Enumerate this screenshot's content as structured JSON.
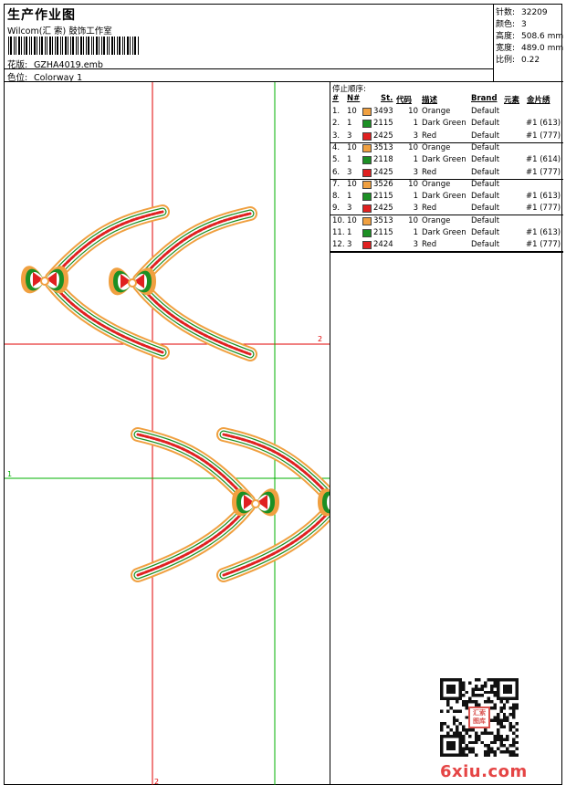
{
  "header": {
    "title": "生产作业图",
    "company": "Wilcom(汇 索) 鼓饰工作室",
    "design_label": "花版:",
    "design_value": "GZHA4019.emb",
    "colorway_label": "色位:",
    "colorway_value": "Colorway 1"
  },
  "stats": [
    {
      "label": "针数:",
      "value": "32209"
    },
    {
      "label": "颜色:",
      "value": "3"
    },
    {
      "label": "高度:",
      "value": "508.6 mm"
    },
    {
      "label": "宽度:",
      "value": "489.0 mm"
    },
    {
      "label": "比例:",
      "value": "0.22"
    }
  ],
  "stop_sequence": {
    "title": "停止顺序:",
    "columns": [
      "#",
      "N#",
      "St.",
      "代码",
      "描述",
      "Brand",
      "元素",
      "金片绣"
    ],
    "rows": [
      {
        "num": "1.",
        "n": "10",
        "color": "#f0a040",
        "st": "3493",
        "code": "10",
        "desc": "Orange",
        "brand": "Default",
        "seq": ""
      },
      {
        "num": "2.",
        "n": "1",
        "color": "#1c8f24",
        "st": "2115",
        "code": "1",
        "desc": "Dark Green",
        "brand": "Default",
        "seq": "#1 (613)"
      },
      {
        "num": "3.",
        "n": "3",
        "color": "#e02020",
        "st": "2425",
        "code": "3",
        "desc": "Red",
        "brand": "Default",
        "seq": "#1 (777)"
      },
      {
        "num": "4.",
        "n": "10",
        "color": "#f0a040",
        "st": "3513",
        "code": "10",
        "desc": "Orange",
        "brand": "Default",
        "seq": ""
      },
      {
        "num": "5.",
        "n": "1",
        "color": "#1c8f24",
        "st": "2118",
        "code": "1",
        "desc": "Dark Green",
        "brand": "Default",
        "seq": "#1 (614)"
      },
      {
        "num": "6.",
        "n": "3",
        "color": "#e02020",
        "st": "2425",
        "code": "3",
        "desc": "Red",
        "brand": "Default",
        "seq": "#1 (777)"
      },
      {
        "num": "7.",
        "n": "10",
        "color": "#f0a040",
        "st": "3526",
        "code": "10",
        "desc": "Orange",
        "brand": "Default",
        "seq": ""
      },
      {
        "num": "8.",
        "n": "1",
        "color": "#1c8f24",
        "st": "2115",
        "code": "1",
        "desc": "Dark Green",
        "brand": "Default",
        "seq": "#1 (613)"
      },
      {
        "num": "9.",
        "n": "3",
        "color": "#e02020",
        "st": "2425",
        "code": "3",
        "desc": "Red",
        "brand": "Default",
        "seq": "#1 (777)"
      },
      {
        "num": "10.",
        "n": "10",
        "color": "#f0a040",
        "st": "3513",
        "code": "10",
        "desc": "Orange",
        "brand": "Default",
        "seq": ""
      },
      {
        "num": "11.",
        "n": "1",
        "color": "#1c8f24",
        "st": "2115",
        "code": "1",
        "desc": "Dark Green",
        "brand": "Default",
        "seq": "#1 (613)"
      },
      {
        "num": "12.",
        "n": "3",
        "color": "#e02020",
        "st": "2424",
        "code": "3",
        "desc": "Red",
        "brand": "Default",
        "seq": "#1 (777)"
      }
    ]
  },
  "canvas": {
    "axis_label_x": "2",
    "axis_label_y": "1",
    "axis_label_bottom": "2"
  },
  "brand": {
    "site_logo": "6xiu.com",
    "seal_text": "汇索 图库"
  },
  "colors": {
    "orange": "#f0a040",
    "dark_green": "#1c8f24",
    "red": "#e02020",
    "guide_red": "#e00000",
    "guide_green": "#00b000"
  }
}
